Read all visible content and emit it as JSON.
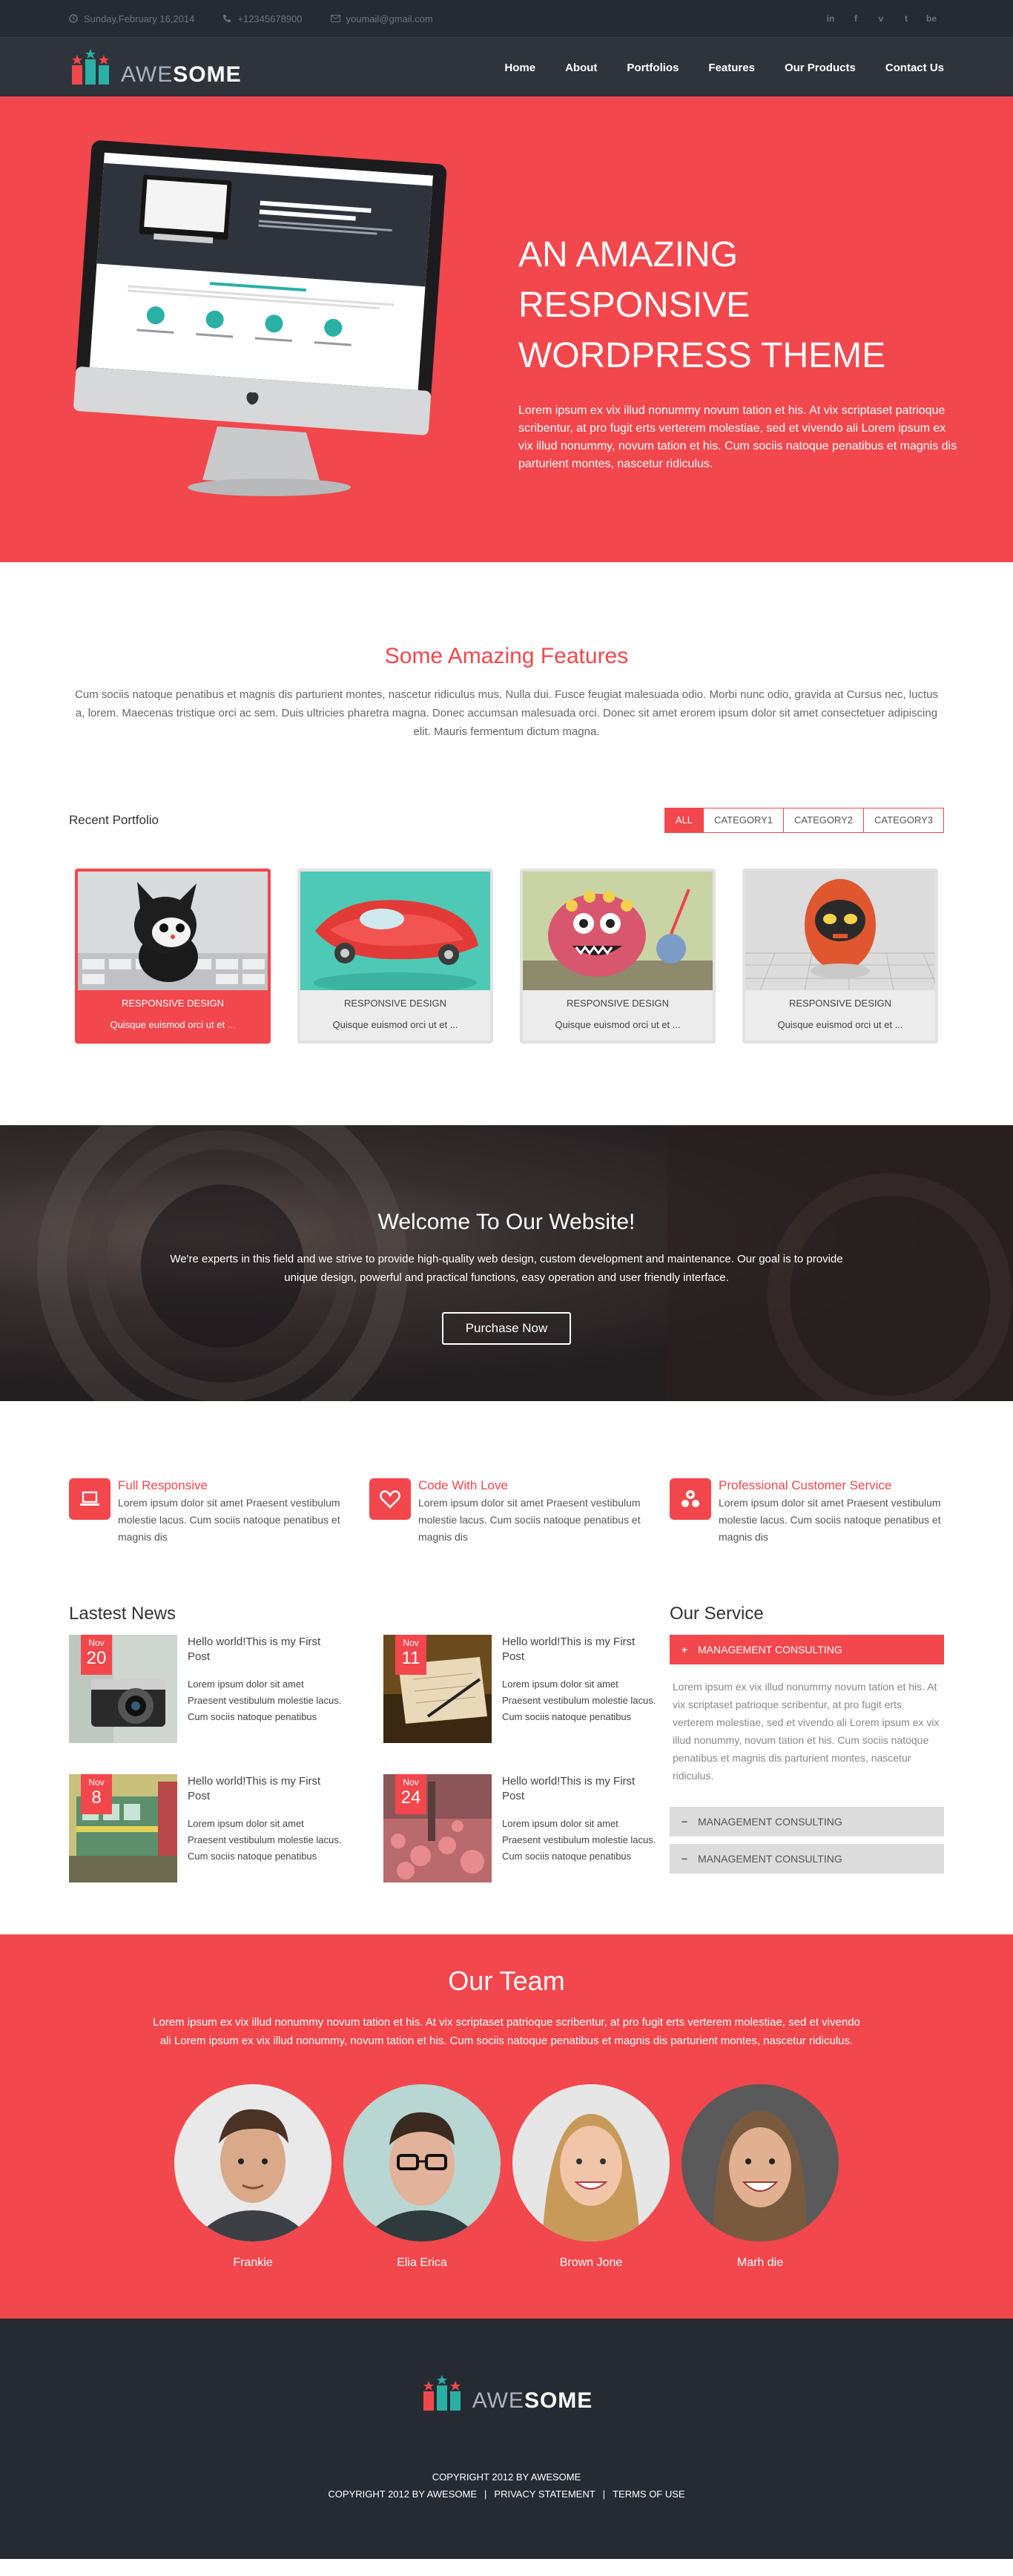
{
  "topbar": {
    "date": "Sunday,February 16,2014",
    "phone": "+12345678900",
    "email": "youmail@gmail.com",
    "social": [
      "in",
      "f",
      "v",
      "t",
      "be"
    ]
  },
  "header": {
    "logo_part1": "AWE",
    "logo_part2": "SOME",
    "nav": [
      "Home",
      "About",
      "Portfolios",
      "Features",
      "Our Products",
      "Contact Us"
    ]
  },
  "hero": {
    "title": "AN AMAZING RESPONSIVE WORDPRESS THEME",
    "text": "Lorem ipsum ex vix illud nonummy novum tation et his. At vix scriptaset patrioque scribentur, at pro fugit erts verterem molestiae, sed et vivendo ali Lorem ipsum ex vix illud nonummy, novum tation et his. Cum sociis natoque penatibus et magnis dis parturient montes, nascetur ridiculus.",
    "screen_title": "AN AMAZING RESPONSIVE WORDPRESS THEME",
    "screen_sub": "The best choise for your business"
  },
  "features": {
    "title": "Some Amazing Features",
    "text": "Cum sociis natoque penatibus et magnis dis parturient montes, nascetur ridiculus mus. Nulla dui. Fusce feugiat malesuada odio. Morbi nunc odio, gravida at Cursus nec, luctus a, lorem. Maecenas tristique orci ac sem. Duis ultricies pharetra magna. Donec accumsan malesuada orci. Donec sit amet erorem ipsum dolor sit amet consectetuer adipiscing elit. Mauris fermentum dictum magna."
  },
  "portfolio": {
    "title": "Recent Portfolio",
    "filters": [
      "ALL",
      "CATEGORY1",
      "CATEGORY2",
      "CATEGORY3"
    ],
    "items": [
      {
        "category": "RESPONSIVE DESIGN",
        "desc": "Quisque euismod orci ut et ..."
      },
      {
        "category": "RESPONSIVE DESIGN",
        "desc": "Quisque euismod orci ut et ..."
      },
      {
        "category": "RESPONSIVE DESIGN",
        "desc": "Quisque euismod orci ut et ..."
      },
      {
        "category": "RESPONSIVE DESIGN",
        "desc": "Quisque euismod orci ut et ..."
      }
    ]
  },
  "welcome": {
    "title": "Welcome To Our Website!",
    "text": "We're experts in this field and we strive to provide high-quality web design, custom development and maintenance. Our goal is to provide unique design, powerful and practical functions, easy operation and user friendly interface.",
    "button": "Purchase Now"
  },
  "services": [
    {
      "title": "Full Responsive",
      "text": "Lorem ipsum dolor sit amet Praesent vestibulum molestie lacus. Cum sociis natoque penatibus et magnis dis"
    },
    {
      "title": "Code With Love",
      "text": "Lorem ipsum dolor sit amet Praesent vestibulum molestie lacus. Cum sociis natoque penatibus et magnis dis"
    },
    {
      "title": "Professional Customer Service",
      "text": "Lorem ipsum dolor sit amet Praesent vestibulum molestie lacus. Cum sociis natoque penatibus et magnis dis"
    }
  ],
  "news": {
    "title": "Lastest News",
    "items": [
      {
        "month": "Nov",
        "day": "20",
        "title": "Hello world!This is my First Post",
        "text": "Lorem ipsum dolor sit amet Praesent vestibulum molestie lacus. Cum sociis natoque penatibus"
      },
      {
        "month": "Nov",
        "day": "11",
        "title": "Hello world!This is my First Post",
        "text": "Lorem ipsum dolor sit amet Praesent vestibulum molestie lacus. Cum sociis natoque penatibus"
      },
      {
        "month": "Nov",
        "day": "8",
        "title": "Hello world!This is my First Post",
        "text": "Lorem ipsum dolor sit amet Praesent vestibulum molestie lacus. Cum sociis natoque penatibus"
      },
      {
        "month": "Nov",
        "day": "24",
        "title": "Hello world!This is my First Post",
        "text": "Lorem ipsum dolor sit amet Praesent vestibulum molestie lacus. Cum sociis natoque penatibus"
      }
    ]
  },
  "our_service": {
    "title": "Our Service",
    "items": [
      {
        "label": "MANAGEMENT CONSULTING",
        "sign": "+"
      },
      {
        "label": "MANAGEMENT CONSULTING",
        "sign": "−"
      },
      {
        "label": "MANAGEMENT CONSULTING",
        "sign": "−"
      }
    ],
    "open_text": "Lorem ipsum ex vix illud nonummy novum tation et his. At vix scriptaset patrioque scribentur, at pro fugit erts verterem molestiae, sed et vivendo ali Lorem ipsum ex vix illud nonummy, novum tation et his. Cum sociis natoque penatibus et magnis dis parturient montes, nascetur ridiculus."
  },
  "team": {
    "title": "Our Team",
    "text": "Lorem ipsum ex vix illud nonummy novum tation et his. At vix scriptaset patrioque scribentur, at pro fugit erts verterem molestiae, sed et vivendo ali Lorem ipsum ex vix illud nonummy, novum tation et his. Cum sociis natoque penatibus et magnis dis parturient montes, nascetur ridiculus.",
    "members": [
      "Frankie",
      "Elia Erica",
      "Brown Jone",
      "Marh die"
    ]
  },
  "footer": {
    "copyright": "COPYRIGHT 2012 BY AWESOME",
    "links": [
      "COPYRIGHT 2012 BY AWESOME",
      "PRIVACY STATEMENT",
      "TERMS OF USE"
    ]
  },
  "colors": {
    "accent": "#f2474c",
    "dark": "#262b33",
    "header": "#2f343c"
  }
}
